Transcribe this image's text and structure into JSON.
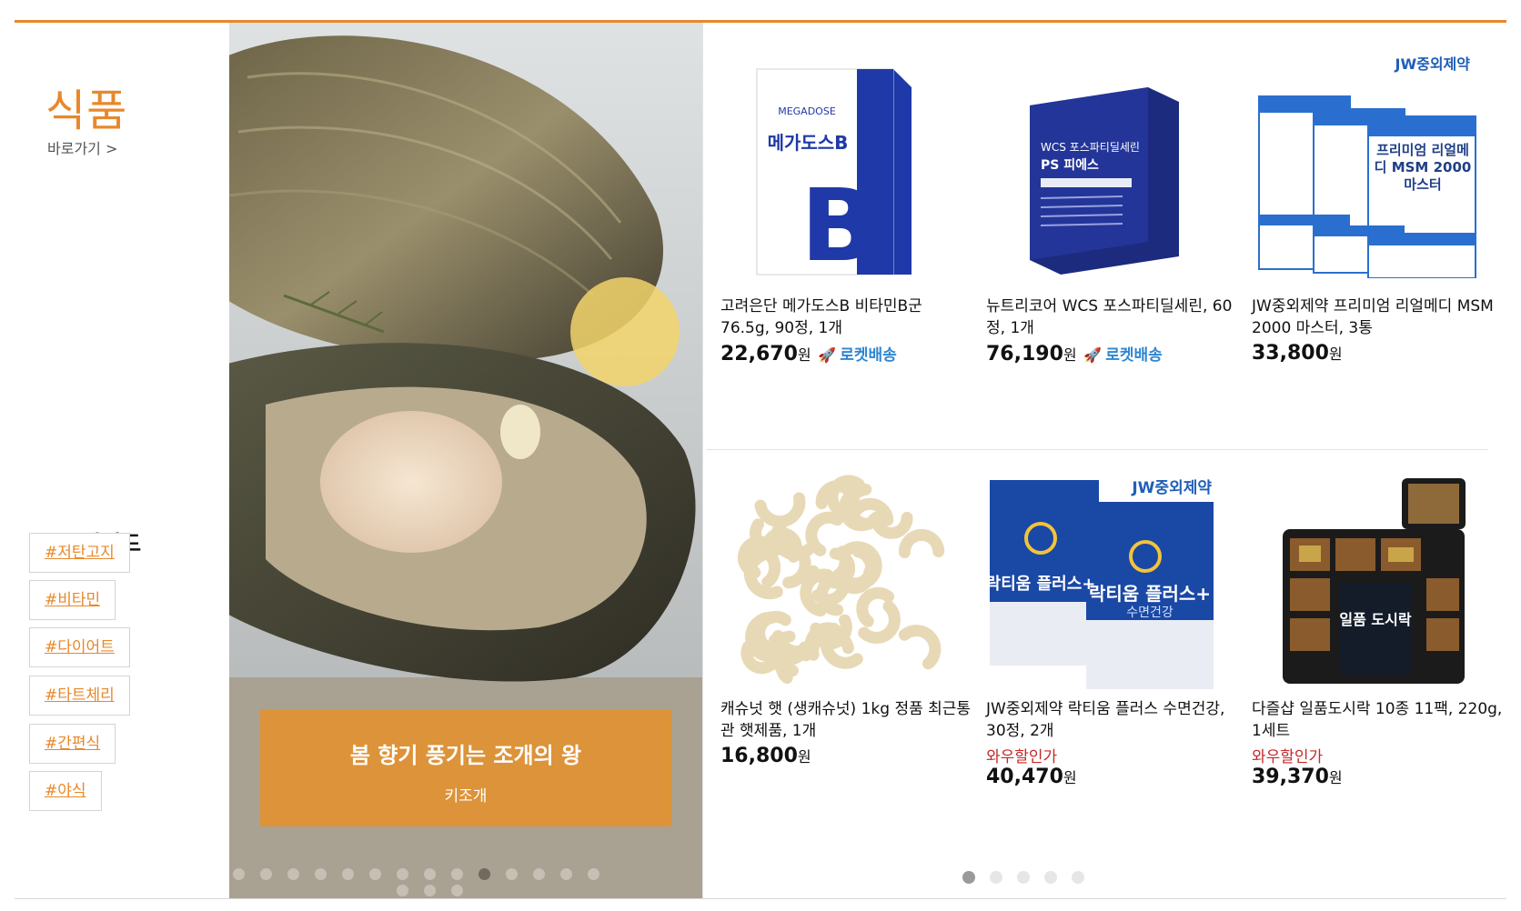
{
  "category": {
    "title": "식품",
    "shortcut_label": "바로가기 >"
  },
  "hot_keywords": {
    "title": "HOT키워드",
    "items": [
      "#저탄고지",
      "#비타민",
      "#다이어트",
      "#타트체리",
      "#간편식",
      "#야식"
    ]
  },
  "banner": {
    "headline": "봄 향기 풍기는 조개의 왕",
    "subtitle": "키조개",
    "dots_total": 17,
    "active_dot": 9
  },
  "products": [
    {
      "name": "고려은단 메가도스B 비타민B군 76.5g, 90정, 1개",
      "price": "22,670",
      "won": "원",
      "rocket": "로켓배송",
      "tag": ""
    },
    {
      "name": "뉴트리코어 WCS 포스파티딜세린, 60정, 1개",
      "price": "76,190",
      "won": "원",
      "rocket": "로켓배송",
      "tag": ""
    },
    {
      "name": "JW중외제약 프리미엄 리얼메디 MSM 2000 마스터, 3통",
      "price": "33,800",
      "won": "원",
      "rocket": "",
      "tag": ""
    },
    {
      "name": "캐슈넛 햇 (생캐슈넛) 1kg 정품 최근통관 햇제품, 1개",
      "price": "16,800",
      "won": "원",
      "rocket": "",
      "tag": ""
    },
    {
      "name": "JW중외제약 락티움 플러스 수면건강, 30정, 2개",
      "price": "40,470",
      "won": "원",
      "rocket": "",
      "tag": "와우할인가"
    },
    {
      "name": "다즐샵 일품도시락 10종 11팩, 220g, 1세트",
      "price": "39,370",
      "won": "원",
      "rocket": "",
      "tag": "와우할인가"
    }
  ],
  "product_image_text": {
    "megadose_brand": "MEGADOSE",
    "megadose_name": "메가도스B",
    "megadose_letter": "B",
    "wcs_title": "WCS 포스파티딜세린",
    "wcs_sub": "PS 피에스",
    "jw_logo": "JW중외제약",
    "msm_name": "프리미엄 리얼메디 MSM 2000 마스터",
    "lactium_name": "락티움 플러스+",
    "lactium_sub": "수면건강",
    "lunchbox_name": "일품 도시락"
  },
  "product_pager": {
    "total": 5,
    "active": 0
  },
  "colors": {
    "accent": "#e8882b",
    "rocket": "#2e86d1",
    "sale": "#c62828",
    "banner_box": "#dd9339"
  }
}
